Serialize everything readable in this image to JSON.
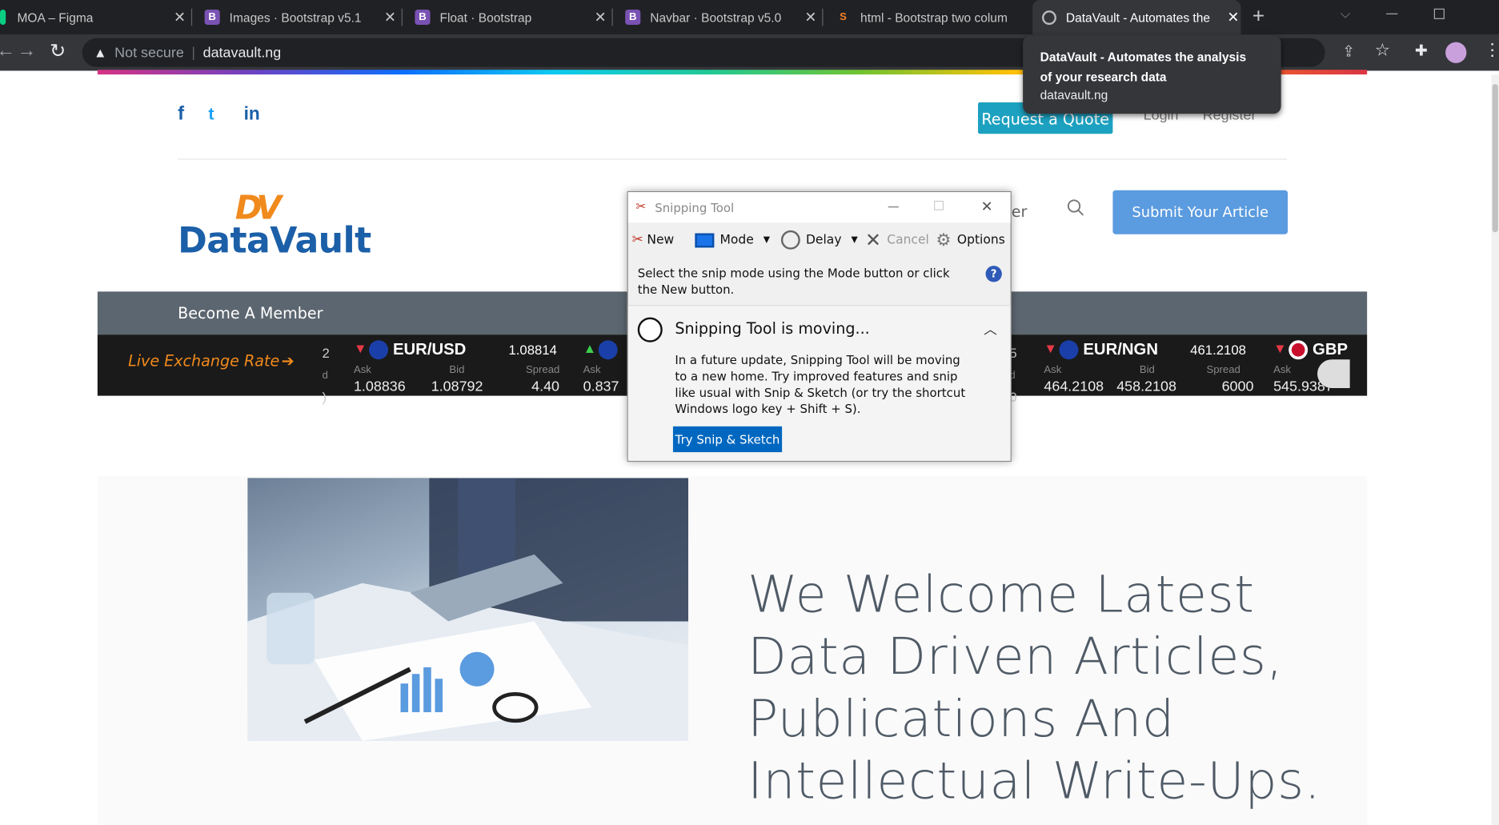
{
  "browser": {
    "tabs": [
      {
        "title": "MOA – Figma",
        "favicon": "F"
      },
      {
        "title": "Images · Bootstrap v5.1",
        "favicon": "B"
      },
      {
        "title": "Float · Bootstrap",
        "favicon": "B"
      },
      {
        "title": "Navbar · Bootstrap v5.0",
        "favicon": "B"
      },
      {
        "title": "html - Bootstrap two colum",
        "favicon": "S"
      },
      {
        "title": "DataVault - Automates the",
        "favicon": "G"
      }
    ],
    "new_tab": "+",
    "security_label": "Not secure",
    "url": "datavault.ng",
    "tooltip": {
      "title": "DataVault - Automates the analysis of your research data",
      "url": "datavault.ng"
    }
  },
  "header": {
    "social": [
      "f",
      "t",
      "in"
    ],
    "request_quote": "Request a Quote",
    "login": "Login",
    "register": "Register",
    "nav_partial": "er",
    "submit_article": "Submit Your Article",
    "logo_text": "DataVault",
    "logo_mark": "DV"
  },
  "member_bar": {
    "label": "Become A Member"
  },
  "ticker": {
    "label": "Live Exchange Rate",
    "arrow": "➔",
    "items": [
      {
        "pair": "EUR/USD",
        "dir": "down",
        "price": "1.08814",
        "ask_label": "Ask",
        "bid_label": "Bid",
        "spread_label": "Spread",
        "ask": "1.08836",
        "bid": "1.08792",
        "spread": "4.40"
      },
      {
        "pair": "EUR/NGN",
        "dir": "down",
        "price": "461.2108",
        "ask_label": "Ask",
        "bid_label": "Bid",
        "spread_label": "Spread",
        "ask": "464.2108",
        "bid": "458.2108",
        "spread": "6000"
      },
      {
        "pair": "GBP",
        "dir": "down",
        "ask_label": "Ask",
        "ask": "545.9387"
      }
    ],
    "partial": {
      "ask_label": "Ask",
      "ask": "0.837",
      "dir": "up"
    }
  },
  "hero": {
    "lines": [
      "We Welcome Latest",
      "Data Driven Articles,",
      "Publications And",
      "Intellectual Write-Ups."
    ]
  },
  "snipping_tool": {
    "title": "Snipping Tool",
    "new": "New",
    "mode": "Mode",
    "delay": "Delay",
    "cancel": "Cancel",
    "options": "Options",
    "instruction": "Select the snip mode using the Mode button or click the New button.",
    "notice_title": "Snipping Tool is moving...",
    "notice_body": "In a future update, Snipping Tool will be moving to a new home. Try improved features and snip like usual with Snip & Sketch (or try the shortcut Windows logo key + Shift + S).",
    "try_button": "Try Snip & Sketch"
  },
  "colors": {
    "accent": "#1da1c0",
    "submit": "#5b9bdf",
    "logo_blue": "#1b5fa8",
    "logo_orange": "#f08a1c",
    "member_bar": "#5c6670",
    "hero_text": "#4f5a66",
    "ticker_orange": "#f08a1c"
  }
}
